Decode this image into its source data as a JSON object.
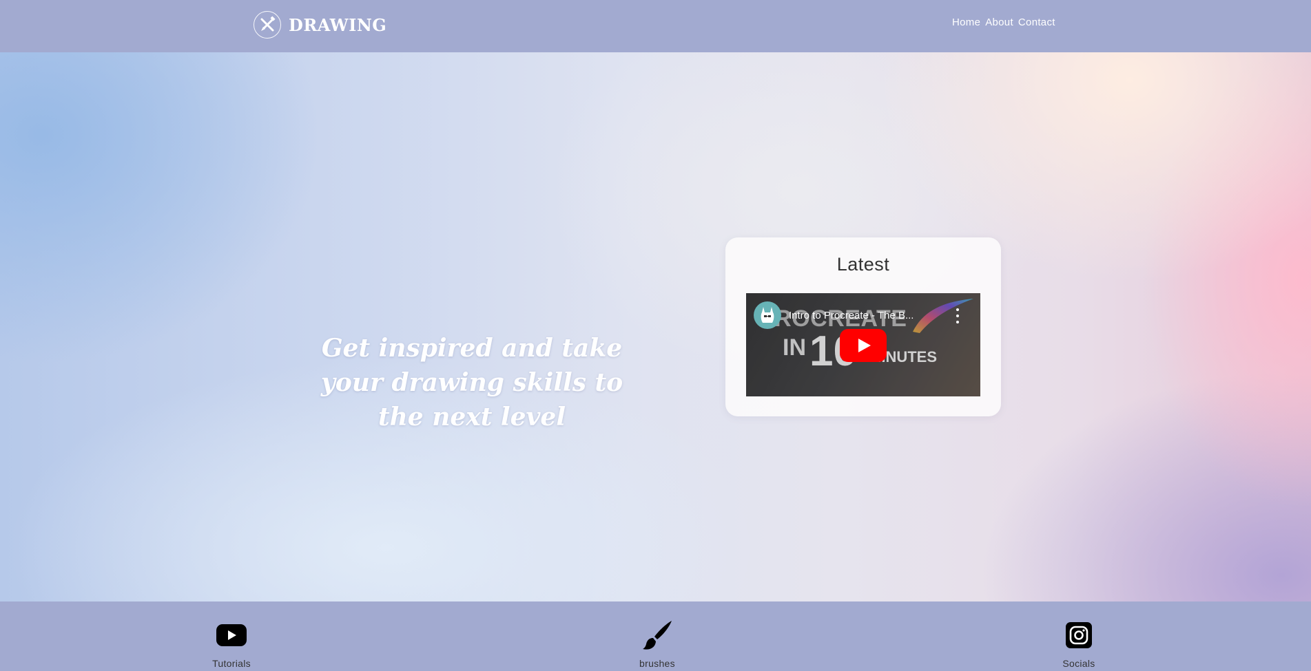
{
  "header": {
    "logo_text": "DRAWING",
    "logo_icon": "crossed-pencil-brush-icon",
    "nav": [
      {
        "label": "Home"
      },
      {
        "label": "About"
      },
      {
        "label": "Contact"
      }
    ]
  },
  "hero": {
    "headline": "Get inspired and take your drawing skills to the next level"
  },
  "latest": {
    "title": "Latest",
    "video": {
      "title": "Intro to Procreate - The B...",
      "thumbnail_line1": "PROCREATE",
      "thumbnail_in": "IN",
      "thumbnail_number": "10",
      "thumbnail_minutes": "MINUTES",
      "play_icon": "youtube-play-icon",
      "menu_icon": "more-vert-icon",
      "channel_icon": "llama-avatar-icon"
    }
  },
  "footer": {
    "items": [
      {
        "label": "Tutorials",
        "icon": "youtube-icon"
      },
      {
        "label": "brushes",
        "icon": "paintbrush-icon"
      },
      {
        "label": "Socials",
        "icon": "instagram-icon"
      }
    ]
  },
  "colors": {
    "header_bg": "#a2aad0",
    "footer_bg": "#a2aad0",
    "youtube_red": "#ff0000"
  }
}
